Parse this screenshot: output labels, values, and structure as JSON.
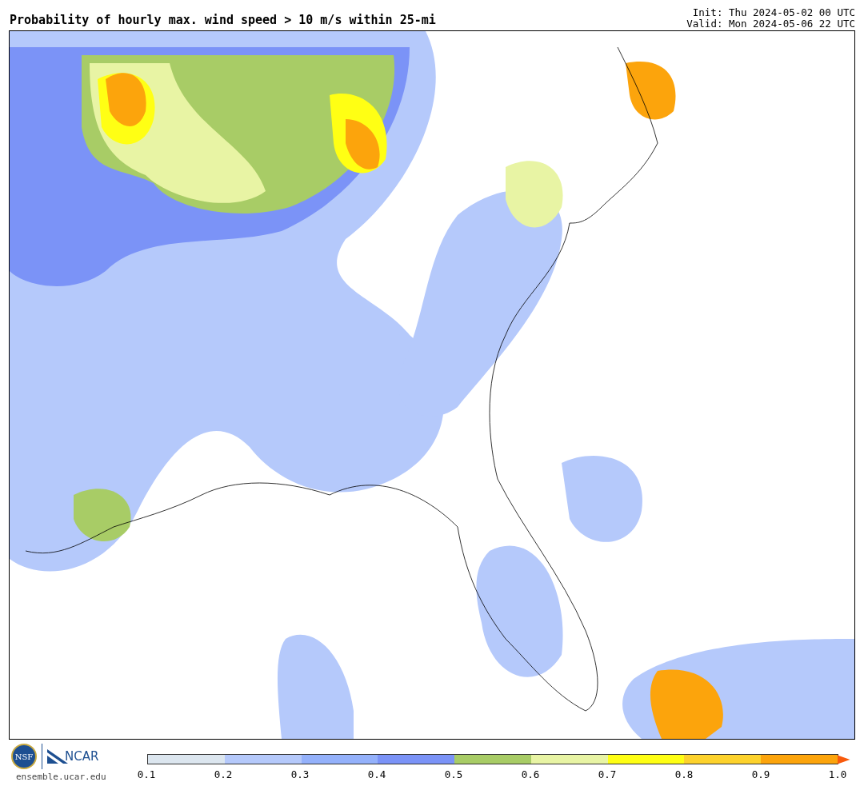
{
  "title": "Probability of hourly max. wind speed > 10 m/s within 25-mi",
  "init": "Init: Thu 2024-05-02 00 UTC",
  "valid": "Valid: Mon 2024-05-06 22 UTC",
  "logos": {
    "nsf": "NSF",
    "ncar": "NCAR",
    "site": "ensemble.ucar.edu"
  },
  "colorbar": {
    "segments": [
      {
        "color": "#dce6ef"
      },
      {
        "color": "#b5c9fb"
      },
      {
        "color": "#94b1fb"
      },
      {
        "color": "#7b93f7"
      },
      {
        "color": "#a8cc66"
      },
      {
        "color": "#e8f4a4"
      },
      {
        "color": "#ffff14"
      },
      {
        "color": "#fdd22c"
      },
      {
        "color": "#fca40c"
      }
    ],
    "extend": {
      "color": "#f85a0c"
    },
    "ticks": [
      "0.1",
      "0.2",
      "0.3",
      "0.4",
      "0.5",
      "0.6",
      "0.7",
      "0.8",
      "0.9",
      "1.0"
    ]
  }
}
